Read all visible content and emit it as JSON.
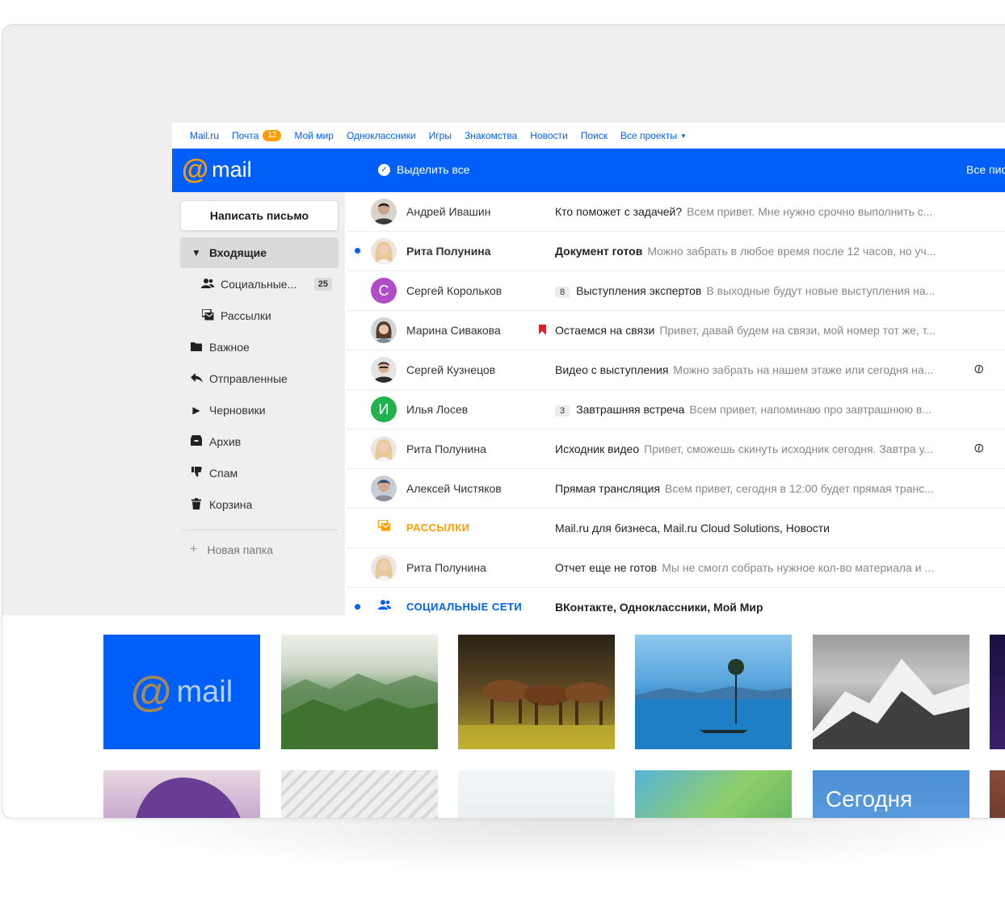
{
  "portal": {
    "links": [
      "Mail.ru",
      "Почта",
      "Мой мир",
      "Одноклассники",
      "Игры",
      "Знакомства",
      "Новости",
      "Поиск",
      "Все проекты"
    ],
    "mail_badge": "12"
  },
  "header": {
    "logo_at": "@",
    "logo_text": "mail",
    "select_all": "Выделить все",
    "all_letters": "Все пис"
  },
  "sidebar": {
    "compose": "Написать письмо",
    "folders": [
      {
        "label": "Входящие",
        "icon": "caret-down-icon"
      },
      {
        "label": "Социальные...",
        "count": "25",
        "icon": "social-icon"
      },
      {
        "label": "Рассылки",
        "icon": "newsletter-icon"
      },
      {
        "label": "Важное",
        "icon": "folder-icon"
      },
      {
        "label": "Отправленные",
        "icon": "reply-icon"
      },
      {
        "label": "Черновики",
        "icon": "caret-right-icon"
      },
      {
        "label": "Архив",
        "icon": "archive-icon"
      },
      {
        "label": "Спам",
        "icon": "thumbs-down-icon"
      },
      {
        "label": "Корзина",
        "icon": "trash-icon"
      }
    ],
    "new_folder": "Новая папка"
  },
  "messages": [
    {
      "sender": "Андрей Ивашин",
      "subject": "Кто поможет с задачей?",
      "snippet": "Всем привет. Мне нужно срочно выполнить с..."
    },
    {
      "sender": "Рита Полунина",
      "subject": "Документ готов",
      "snippet": "Можно забрать в любое время после 12 часов, но уч..."
    },
    {
      "sender": "Сергей Корольков",
      "avatar_letter": "С",
      "thread_count": "8",
      "subject": "Выступления экспертов",
      "snippet": "В выходные будут новые выступления на..."
    },
    {
      "sender": "Марина Сивакова",
      "subject": "Остаемся на связи",
      "snippet": "Привет, давай будем на связи, мой номер тот же, т..."
    },
    {
      "sender": "Сергей Кузнецов",
      "subject": "Видео с выступления",
      "snippet": "Можно забрать на нашем этаже или сегодня на..."
    },
    {
      "sender": "Илья Лосев",
      "avatar_letter": "И",
      "thread_count": "3",
      "subject": "Завтрашняя встреча",
      "snippet": "Всем привет, напоминаю про завтрашнюю в..."
    },
    {
      "sender": "Рита Полунина",
      "subject": "Исходник видео",
      "snippet": "Привет, сможешь скинуть исходник сегодня. Завтра у..."
    },
    {
      "sender": "Алексей Чистяков",
      "subject": "Прямая трансляция",
      "snippet": "Всем привет, сегодня в 12:00 будет прямая транс..."
    },
    {
      "sender": "РАССЫЛКИ",
      "subject": "Mail.ru для бизнеса, Mail.ru Cloud Solutions, Новости",
      "snippet": ""
    },
    {
      "sender": "Рита Полунина",
      "subject": "Отчет еще не готов",
      "snippet": "Мы не смогл собрать нужное кол-во материала и ..."
    },
    {
      "sender": "СОЦИАЛЬНЫЕ СЕТИ",
      "subject": "ВКонтакте, Одноклассники, Мой Мир",
      "snippet": ""
    }
  ],
  "gallery": {
    "logo_at": "@",
    "logo_text": "mail",
    "today_text": "Сегодня"
  },
  "colors": {
    "brand_blue": "#005ff9",
    "brand_orange": "#ff9e00",
    "flag_red": "#e51c23"
  }
}
